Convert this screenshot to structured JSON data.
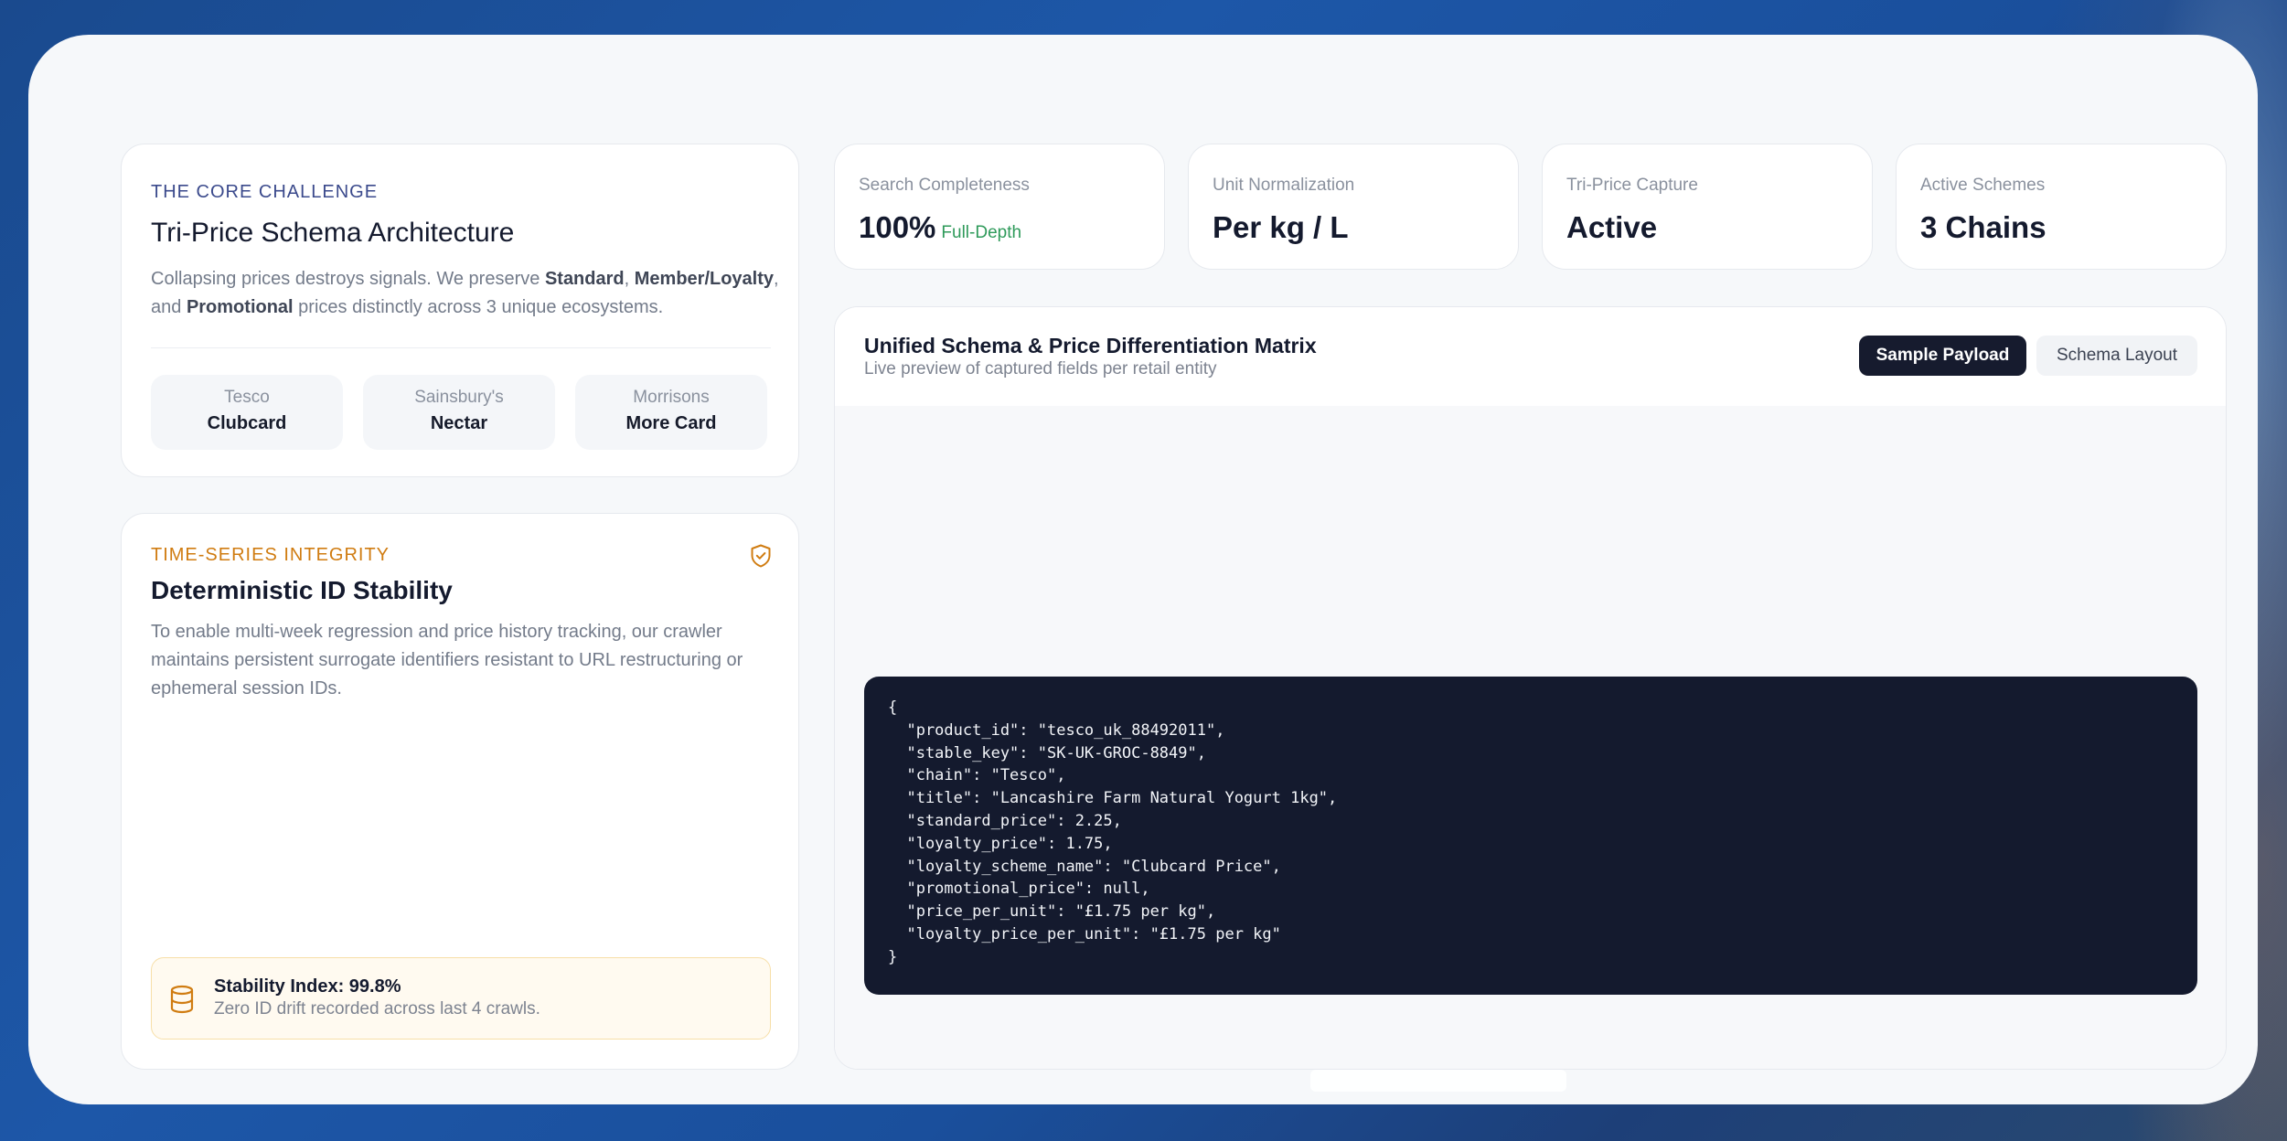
{
  "challenge": {
    "eyebrow": "THE CORE CHALLENGE",
    "title": "Tri-Price Schema Architecture",
    "desc_part1": "Collapsing prices destroys signals. We preserve ",
    "desc_standard": "Standard",
    "desc_sep1": ", ",
    "desc_member": "Member/Loyalty",
    "desc_sep2": ", and ",
    "desc_promo": "Promotional",
    "desc_part2": " prices distinctly across 3 unique ecosystems.",
    "chips": [
      {
        "name": "Tesco",
        "scheme": "Clubcard"
      },
      {
        "name": "Sainsbury's",
        "scheme": "Nectar"
      },
      {
        "name": "Morrisons",
        "scheme": "More Card"
      }
    ]
  },
  "integrity": {
    "eyebrow": "TIME-SERIES INTEGRITY",
    "icon": "shield-check-icon",
    "title": "Deterministic ID Stability",
    "desc": "To enable multi-week regression and price history tracking, our crawler maintains persistent surrogate identifiers resistant to URL restructuring or ephemeral session IDs.",
    "stability_title": "Stability Index: 99.8%",
    "stability_sub": "Zero ID drift recorded across last 4 crawls."
  },
  "metrics": [
    {
      "label": "Search Completeness",
      "value": "100%",
      "sub": "Full-Depth"
    },
    {
      "label": "Unit Normalization",
      "value": "Per kg / L"
    },
    {
      "label": "Tri-Price Capture",
      "value": "Active"
    },
    {
      "label": "Active Schemes",
      "value": "3 Chains"
    }
  ],
  "matrix": {
    "title": "Unified Schema & Price Differentiation Matrix",
    "subtitle": "Live preview of captured fields per retail entity",
    "tab_active": "Sample Payload",
    "tab_idle": "Schema Layout",
    "code": "{\n  \"product_id\": \"tesco_uk_88492011\",\n  \"stable_key\": \"SK-UK-GROC-8849\",\n  \"chain\": \"Tesco\",\n  \"title\": \"Lancashire Farm Natural Yogurt 1kg\",\n  \"standard_price\": 2.25,\n  \"loyalty_price\": 1.75,\n  \"loyalty_scheme_name\": \"Clubcard Price\",\n  \"promotional_price\": null,\n  \"price_per_unit\": \"£1.75 per kg\",\n  \"loyalty_price_per_unit\": \"£1.75 per kg\"\n}"
  },
  "colors": {
    "accent_dark": "#161b2e",
    "eyebrow_blue": "#3b4a8c",
    "eyebrow_orange": "#d07c11",
    "success_green": "#2e9a5a"
  }
}
